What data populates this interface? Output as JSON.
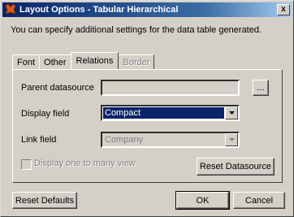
{
  "window": {
    "title": "Layout Options - Tabular Hierarchical",
    "close_label": "x"
  },
  "description": "You can specify additional settings for the data table generated.",
  "tabs": [
    {
      "label": "Font",
      "state": "normal"
    },
    {
      "label": "Other",
      "state": "normal"
    },
    {
      "label": "Relations",
      "state": "active"
    },
    {
      "label": "Border",
      "state": "disabled"
    }
  ],
  "relations": {
    "parent_datasource": {
      "label": "Parent datasource",
      "value": "",
      "browse_label": "..."
    },
    "display_field": {
      "label": "Display field",
      "value": "Compact"
    },
    "link_field": {
      "label": "Link field",
      "value": "Company"
    },
    "one_to_many": {
      "label": "Display one to many view",
      "checked": false
    },
    "reset_datasource_label": "Reset Datasource"
  },
  "footer": {
    "reset_defaults_label": "Reset Defaults",
    "ok_label": "OK",
    "cancel_label": "Cancel"
  }
}
